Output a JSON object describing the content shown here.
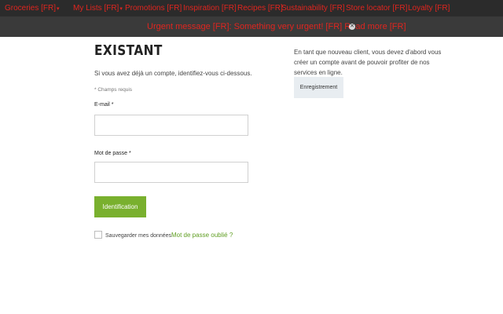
{
  "nav": {
    "items": [
      {
        "label": "Groceries [FR]",
        "caret": "▾"
      },
      {
        "label": "My Lists [FR]",
        "caret": "▾"
      },
      {
        "label": "Promotions [FR]",
        "caret": ""
      },
      {
        "label": "Inspiration [FR]",
        "caret": ""
      },
      {
        "label": "Recipes [FR]",
        "caret": ""
      },
      {
        "label": "Sustainability [FR]",
        "caret": ""
      },
      {
        "label": "Store locator [FR]",
        "caret": ""
      },
      {
        "label": "Loyalty [FR]",
        "caret": ""
      }
    ]
  },
  "banner": {
    "prefix": "Urgent message [FR]:",
    "text": " Something very urgent! [FR] ",
    "link": "Read more [FR]",
    "close_icon": "close-icon"
  },
  "login": {
    "title": "EXISTANT",
    "intro": "Si vous avez déjà un compte, identifiez-vous ci-dessous.",
    "required_note": "* Champs requis",
    "email_label": "E-mail *",
    "email_value": "",
    "password_label": "Mot de passe *",
    "password_value": "",
    "submit_label": "Identification",
    "remember_label": "Sauvegarder mes données",
    "remember_checked": false,
    "forgot_label": "Mot de passe oublié ?"
  },
  "register": {
    "text": "En tant que nouveau client, vous devez d'abord vous créer un compte avant de pouvoir profiter de nos services en ligne.",
    "button_label": "Enregistrement"
  },
  "colors": {
    "nav_bg": "#2b2b2b",
    "nav_text": "#e0251f",
    "primary_green": "#79b02e",
    "link_green": "#5f9e22"
  }
}
